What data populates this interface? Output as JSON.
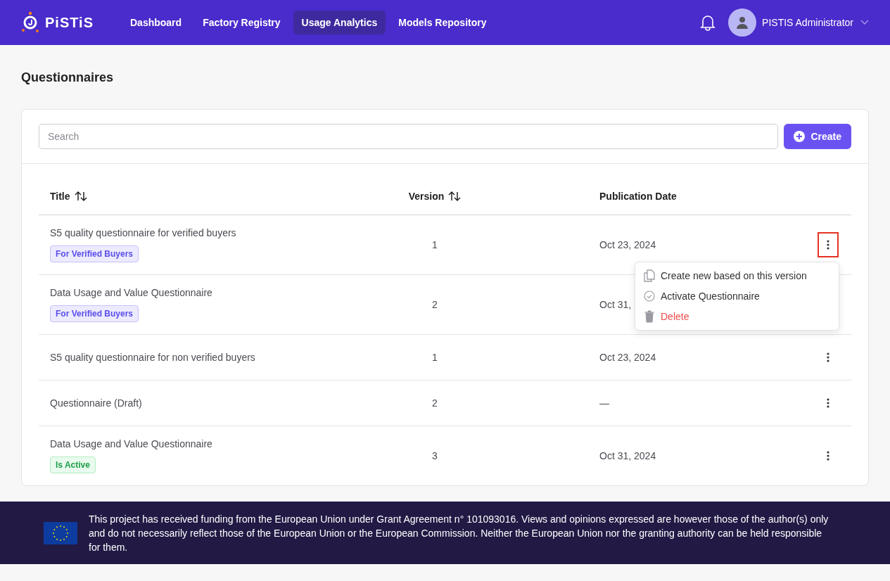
{
  "header": {
    "logo": "PiSTiS",
    "nav": [
      {
        "label": "Dashboard",
        "selected": false
      },
      {
        "label": "Factory Registry",
        "selected": false
      },
      {
        "label": "Usage Analytics",
        "selected": true
      },
      {
        "label": "Models Repository",
        "selected": false
      }
    ],
    "user": "PISTIS Administrator"
  },
  "page_title": "Questionnaires",
  "search": {
    "placeholder": "Search"
  },
  "create_button": "Create",
  "table": {
    "columns": [
      {
        "label": "Title",
        "sortable": true
      },
      {
        "label": "Version",
        "sortable": true
      },
      {
        "label": "Publication Date",
        "sortable": false
      }
    ],
    "rows": [
      {
        "title": "S5 quality questionnaire for verified buyers",
        "tag": {
          "kind": "verified",
          "label": "For Verified Buyers"
        },
        "version": "1",
        "date": "Oct 23, 2024",
        "actions_visible": true,
        "highlighted": true
      },
      {
        "title": "Data Usage and Value Questionnaire",
        "tag": {
          "kind": "verified",
          "label": "For Verified Buyers"
        },
        "version": "2",
        "date": "Oct 31,",
        "actions_visible": false
      },
      {
        "title": "S5 quality questionnaire for non verified buyers",
        "version": "1",
        "date": "Oct 23, 2024",
        "actions_visible": true,
        "highlighted": false
      },
      {
        "title": "Questionnaire (Draft)",
        "version": "2",
        "date": "—",
        "actions_visible": true,
        "highlighted": false
      },
      {
        "title": "Data Usage and Value Questionnaire",
        "tag": {
          "kind": "active",
          "label": "Is Active"
        },
        "version": "3",
        "date": "Oct 31, 2024",
        "actions_visible": true,
        "highlighted": false
      }
    ]
  },
  "menu": {
    "items": [
      {
        "kind": "copy",
        "label": "Create new based on this version"
      },
      {
        "kind": "activate",
        "label": "Activate Questionnaire"
      },
      {
        "kind": "delete",
        "label": "Delete"
      }
    ]
  },
  "footer": {
    "text": "This project has received funding from the European Union under Grant Agreement n° 101093016. Views and opinions expressed are however those of the author(s) only and do not necessarily reflect those of the European Union or the European Commission. Neither the European Union nor the granting authority can be held responsible for them."
  }
}
